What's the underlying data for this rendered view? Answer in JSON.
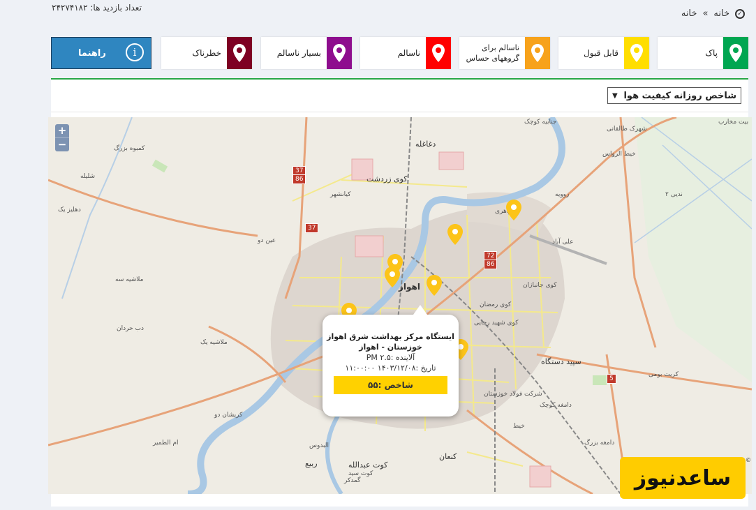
{
  "header": {
    "visit_count": "تعداد بازدید ها: ۲۴۲۷۴۱۸۲",
    "breadcrumb": [
      "خانه",
      "خانه"
    ],
    "breadcrumb_sep": "»"
  },
  "legend": [
    {
      "label": "پاک",
      "color": "#00a651"
    },
    {
      "label": "قابل قبول",
      "color": "#ffde00"
    },
    {
      "label": "ناسالم برای\nگروههای حساس",
      "color": "#f7a21b"
    },
    {
      "label": "ناسالم",
      "color": "#ff0000"
    },
    {
      "label": "بسیار ناسالم",
      "color": "#8e0d8e"
    },
    {
      "label": "خطرناک",
      "color": "#7e0023"
    }
  ],
  "guide_button": {
    "label": "راهنما",
    "icon": "info-icon"
  },
  "index_select": {
    "value": "شاخص روزانه کیفیت هوا"
  },
  "map": {
    "zoom_in": "+",
    "zoom_out": "−",
    "labels": {
      "ahvaz": "اهواز",
      "koy_zartosht": "کوی زردشت",
      "daghela": "دغاغله",
      "koy_ramezan": "کوی رمضان",
      "koy_jonbazan": "کوی جانبازان",
      "koy_shahid_rajai": "کوی شهید رجایی",
      "ali_abad": "علی آباد",
      "sepid_dastgah": "سپید دستگاه",
      "kot_abdollah": "کوت عبدالله",
      "koganeh": "کنعان",
      "rabie": "ربیع",
      "ein_do": "عین دو",
      "molashieh": "ملاشیه یک",
      "kemboheh": "کمبوه بزرگ",
      "dob_hardan": "دب حردان",
      "dahliz": "دهلیز یک",
      "shalileh": "شلیله",
      "roveyeh": "زوویه",
      "koy_jevahari": "جواهری",
      "kianshahr": "کیانشهر",
      "foulad": "شرکت فولاد خوزستان",
      "kout_seyed": "کوت سید",
      "damghe_kouchak": "دامغه کوچک",
      "damghe_bozorg": "دامغه بزرگ",
      "khit": "خیط",
      "karit": "کریت بومی",
      "molashieh_seh": "ملاشیه سه",
      "gonbadi": "گمدکر",
      "shahrak": "شهرک طالقانی",
      "bayt": "بیت مخارب",
      "khit_roas": "خیط الرواس",
      "zeyedeh": "جنابیه کوچک",
      "dezfoul": "ندیی ۲",
      "aroud": "ام الطمیر",
      "kurshan": "کریشان دو",
      "ouds": "البدوس"
    },
    "shields": [
      "37",
      "86",
      "37",
      "72",
      "86",
      "5"
    ],
    "watermark": "ساعدنیوز",
    "copyright": "©"
  },
  "popup": {
    "station": "ایستگاه مرکز بهداشت شرق اهواز",
    "province": "خوزستان - اهواز",
    "pollutant": "آلاینده :PM ۲.۵",
    "date": "تاریخ :۱۴۰۳/۱۲/۰۸ ۱۱:۰۰:۰۰",
    "index": "شاخص :۵۵",
    "index_color": "#ffd100"
  },
  "colors": {
    "accent": "#28a745",
    "guide_bg": "#2f86c0",
    "marker": "#fcc419"
  }
}
